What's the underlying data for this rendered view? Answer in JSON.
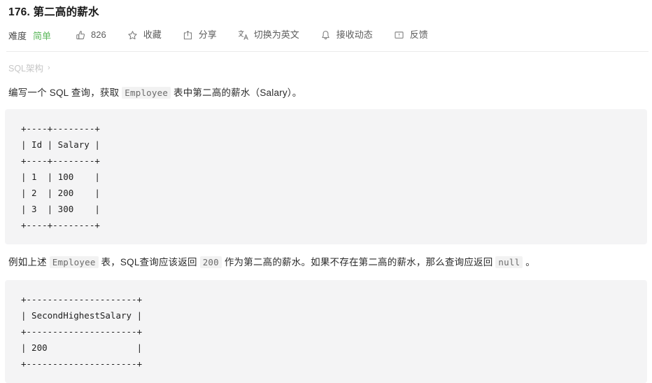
{
  "problem": {
    "title": "176. 第二高的薪水",
    "difficulty_label": "难度",
    "difficulty_value": "简单",
    "difficulty_color": "#5cb85c"
  },
  "toolbar": {
    "like_count": "826",
    "favorite_label": "收藏",
    "share_label": "分享",
    "translate_label": "切换为英文",
    "subscribe_label": "接收动态",
    "feedback_label": "反馈"
  },
  "breadcrumb": {
    "label": "SQL架构",
    "separator": "›"
  },
  "description": {
    "line1_part1": "编写一个 SQL 查询，获取 ",
    "line1_code": "Employee",
    "line1_part2": " 表中第二高的薪水（Salary）。",
    "line2_part1": "例如上述 ",
    "line2_code1": "Employee",
    "line2_part2": " 表，SQL查询应该返回 ",
    "line2_code2": "200",
    "line2_part3": " 作为第二高的薪水。如果不存在第二高的薪水，那么查询应返回 ",
    "line2_code3": "null",
    "line2_part4": " 。"
  },
  "code_blocks": {
    "employee_table": "+----+--------+\n| Id | Salary |\n+----+--------+\n| 1  | 100    |\n| 2  | 200    |\n| 3  | 300    |\n+----+--------+",
    "result_table": "+---------------------+\n| SecondHighestSalary |\n+---------------------+\n| 200                 |\n+---------------------+"
  }
}
